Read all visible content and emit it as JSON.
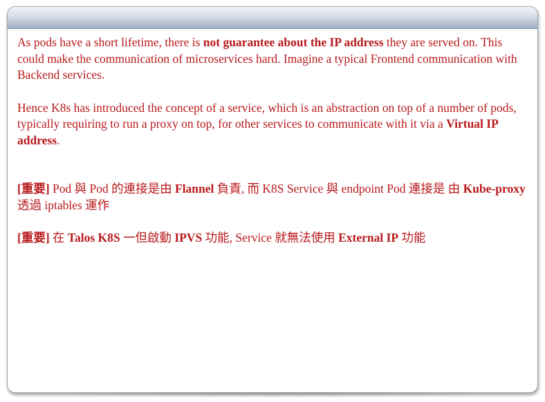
{
  "slide": {
    "p1": {
      "s1": "As pods have a short lifetime, there is ",
      "b1": "not guarantee about the IP address",
      "s2": " they are served on. This could make the communication of microservices hard. Imagine a typical Frontend communication with Backend services."
    },
    "p2": {
      "s1": "Hence K8s has introduced the concept of a service, which is an abstraction on top of a number of pods, typically requiring to run a proxy on top, for other services to communicate with it via a ",
      "b1": "Virtual IP address",
      "s2": "."
    },
    "p3": {
      "tag": "[重要]",
      "s1": " Pod 與 Pod 的連接是由 ",
      "b1": "Flannel",
      "s2": " 負責, 而 K8S Service 與 endpoint Pod 連接是 由 ",
      "b2": "Kube-proxy",
      "s3": " 透過 iptables 運作"
    },
    "p4": {
      "tag": "[重要]",
      "s1": "  在 ",
      "b1": "Talos K8S",
      "s2": " 一但啟動 ",
      "b2": "IPVS",
      "s3": " 功能, Service 就無法使用 ",
      "b3": "External IP",
      "s4": " 功能"
    }
  }
}
